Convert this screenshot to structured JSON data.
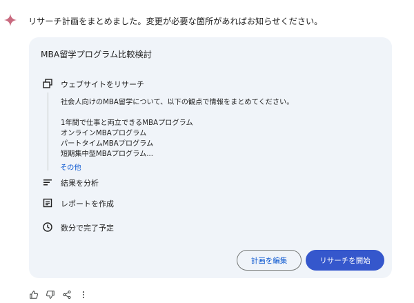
{
  "intro_text": "リサーチ計画をまとめました。変更が必要な箇所があればお知らせください。",
  "card": {
    "title": "MBA留学プログラム比較検討",
    "steps": [
      {
        "icon": "web-search-icon",
        "label": "ウェブサイトをリサーチ"
      },
      {
        "icon": "analyze-icon",
        "label": "結果を分析"
      },
      {
        "icon": "report-icon",
        "label": "レポートを作成"
      },
      {
        "icon": "clock-icon",
        "label": "数分で完了予定"
      }
    ],
    "description": "社会人向けのMBA留学について、以下の観点で情報をまとめてください。",
    "topics": [
      "1年間で仕事と両立できるMBAプログラム",
      "オンラインMBAプログラム",
      "パートタイムMBAプログラム",
      "短期集中型MBAプログラム..."
    ],
    "more_label": "その他",
    "edit_button": "計画を編集",
    "start_button": "リサーチを開始"
  },
  "colors": {
    "card_bg": "#f0f4f9",
    "accent_blue": "#0b57d0",
    "primary_button": "#3557cc",
    "gem_gradient": [
      "#4f6fd6",
      "#c8607a"
    ]
  },
  "footer_icons": [
    "thumbs-up-icon",
    "thumbs-down-icon",
    "share-icon",
    "more-vert-icon"
  ]
}
